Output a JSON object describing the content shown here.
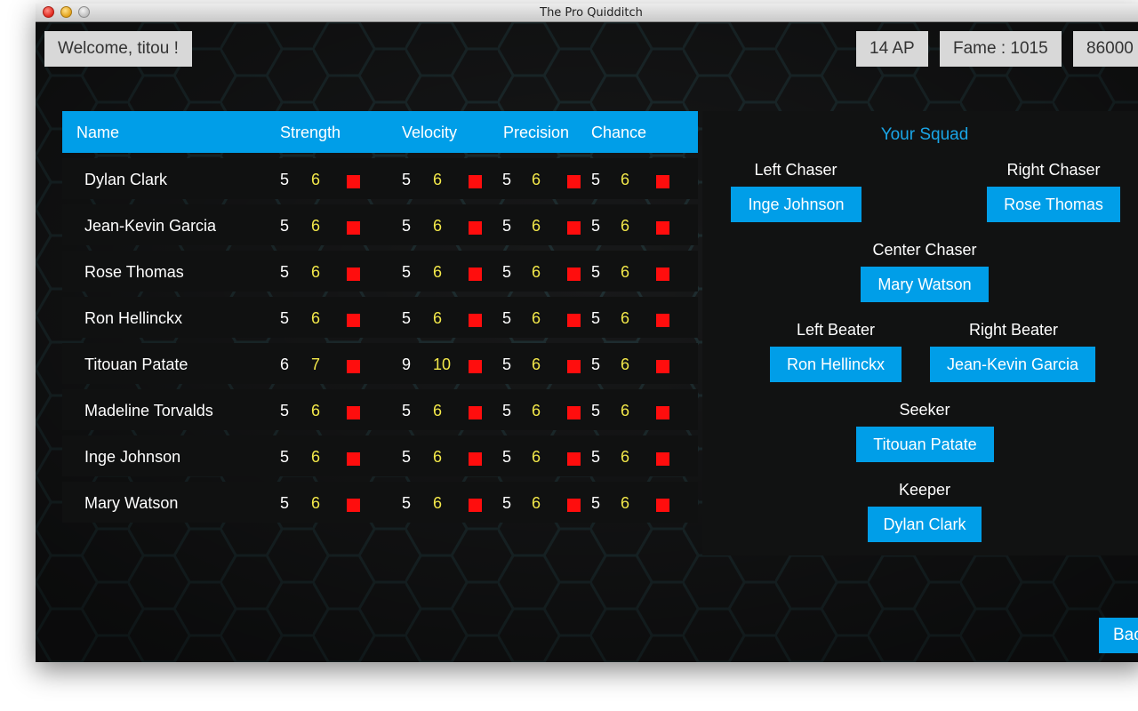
{
  "window": {
    "title": "The Pro Quidditch"
  },
  "header": {
    "welcome": "Welcome, titou !",
    "ap": "14 AP",
    "fame": "Fame : 1015",
    "money": "86000"
  },
  "table": {
    "columns": [
      "Name",
      "Strength",
      "Velocity",
      "Precision",
      "Chance"
    ],
    "rows": [
      {
        "name": "Dylan Clark",
        "strength": [
          "5",
          "6"
        ],
        "velocity": [
          "5",
          "6"
        ],
        "precision": [
          "5",
          "6"
        ],
        "chance": [
          "5",
          "6"
        ]
      },
      {
        "name": "Jean-Kevin Garcia",
        "strength": [
          "5",
          "6"
        ],
        "velocity": [
          "5",
          "6"
        ],
        "precision": [
          "5",
          "6"
        ],
        "chance": [
          "5",
          "6"
        ]
      },
      {
        "name": "Rose Thomas",
        "strength": [
          "5",
          "6"
        ],
        "velocity": [
          "5",
          "6"
        ],
        "precision": [
          "5",
          "6"
        ],
        "chance": [
          "5",
          "6"
        ]
      },
      {
        "name": "Ron Hellinckx",
        "strength": [
          "5",
          "6"
        ],
        "velocity": [
          "5",
          "6"
        ],
        "precision": [
          "5",
          "6"
        ],
        "chance": [
          "5",
          "6"
        ]
      },
      {
        "name": "Titouan Patate",
        "strength": [
          "6",
          "7"
        ],
        "velocity": [
          "9",
          "10"
        ],
        "precision": [
          "5",
          "6"
        ],
        "chance": [
          "5",
          "6"
        ]
      },
      {
        "name": "Madeline Torvalds",
        "strength": [
          "5",
          "6"
        ],
        "velocity": [
          "5",
          "6"
        ],
        "precision": [
          "5",
          "6"
        ],
        "chance": [
          "5",
          "6"
        ]
      },
      {
        "name": "Inge Johnson",
        "strength": [
          "5",
          "6"
        ],
        "velocity": [
          "5",
          "6"
        ],
        "precision": [
          "5",
          "6"
        ],
        "chance": [
          "5",
          "6"
        ]
      },
      {
        "name": "Mary Watson",
        "strength": [
          "5",
          "6"
        ],
        "velocity": [
          "5",
          "6"
        ],
        "precision": [
          "5",
          "6"
        ],
        "chance": [
          "5",
          "6"
        ]
      }
    ]
  },
  "squad": {
    "title": "Your Squad",
    "left_chaser": {
      "label": "Left Chaser",
      "player": "Inge Johnson"
    },
    "right_chaser": {
      "label": "Right Chaser",
      "player": "Rose Thomas"
    },
    "center_chaser": {
      "label": "Center Chaser",
      "player": "Mary Watson"
    },
    "left_beater": {
      "label": "Left Beater",
      "player": "Ron Hellinckx"
    },
    "right_beater": {
      "label": "Right Beater",
      "player": "Jean-Kevin Garcia"
    },
    "seeker": {
      "label": "Seeker",
      "player": "Titouan Patate"
    },
    "keeper": {
      "label": "Keeper",
      "player": "Dylan Clark"
    }
  },
  "footer": {
    "back_label": "Bac"
  },
  "colors": {
    "accent": "#009ee8",
    "background": "#18191a",
    "boost": "#f3e84a",
    "upgrade": "#ff0d0d"
  }
}
